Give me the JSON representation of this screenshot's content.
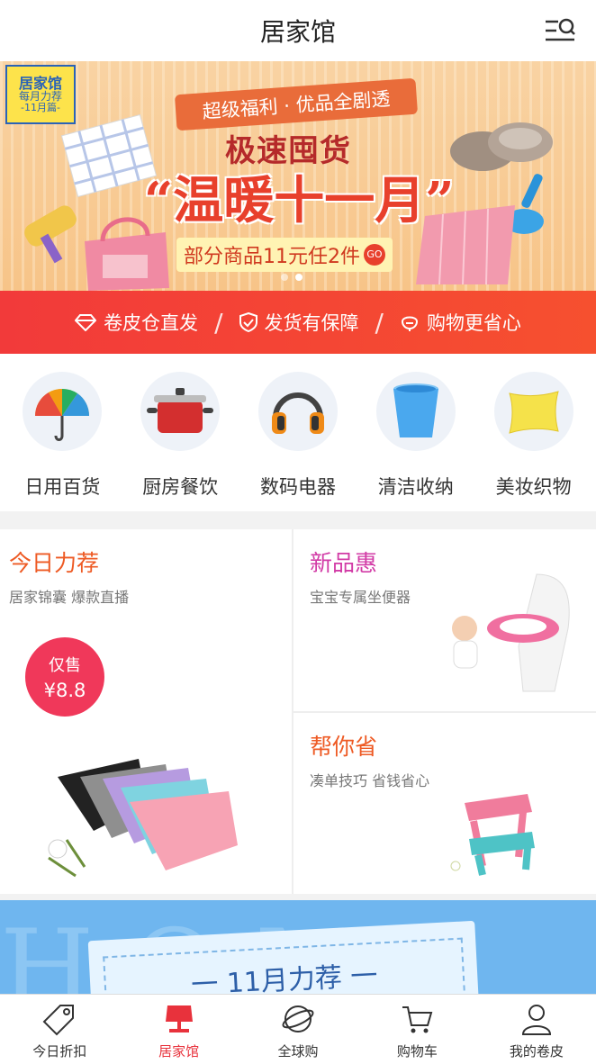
{
  "header": {
    "title": "居家馆",
    "menu_icon": "list-search-icon"
  },
  "banner": {
    "corner_tag": {
      "line1": "居家馆",
      "line2": "每月力荐",
      "line3": "-11月篇-"
    },
    "ribbon": "超级福利 · 优品全剧透",
    "headline": "极速囤货",
    "main": "“温暖十一月”",
    "promo": "部分商品11元任2件",
    "promo_badge": "GO",
    "dots": [
      false,
      true
    ]
  },
  "strip": {
    "items": [
      {
        "icon": "diamond-icon",
        "label": "卷皮仓直发"
      },
      {
        "icon": "shield-check-icon",
        "label": "发货有保障"
      },
      {
        "icon": "piggy-bank-icon",
        "label": "购物更省心"
      }
    ],
    "separator": "/"
  },
  "categories": [
    {
      "label": "日用百货",
      "icon": "umbrella-icon"
    },
    {
      "label": "厨房餐饮",
      "icon": "pot-icon"
    },
    {
      "label": "数码电器",
      "icon": "headphones-icon"
    },
    {
      "label": "清洁收纳",
      "icon": "bucket-icon"
    },
    {
      "label": "美妆织物",
      "icon": "pillow-icon"
    }
  ],
  "promos": {
    "today": {
      "title": "今日力荐",
      "subtitle": "居家锦囊 爆款直播",
      "price_label": "仅售",
      "price": "¥8.8",
      "title_color": "#ee5a24"
    },
    "new": {
      "title": "新品惠",
      "subtitle": "宝宝专属坐便器",
      "title_color": "#d23ba6"
    },
    "save": {
      "title": "帮你省",
      "subtitle": "凑单技巧 省钱省心",
      "title_color": "#ee5a24"
    }
  },
  "bottom_banner": {
    "bg_text": "HOME",
    "card_text": "一 11月力荐 一"
  },
  "tabbar": [
    {
      "label": "今日折扣",
      "icon": "tag-icon",
      "active": false
    },
    {
      "label": "居家馆",
      "icon": "lamp-icon",
      "active": true
    },
    {
      "label": "全球购",
      "icon": "planet-icon",
      "active": false
    },
    {
      "label": "购物车",
      "icon": "cart-icon",
      "active": false
    },
    {
      "label": "我的卷皮",
      "icon": "user-icon",
      "active": false
    }
  ],
  "colors": {
    "accent": "#e8323c",
    "strip": "#f23a3a",
    "price_badge": "#f0385a"
  }
}
